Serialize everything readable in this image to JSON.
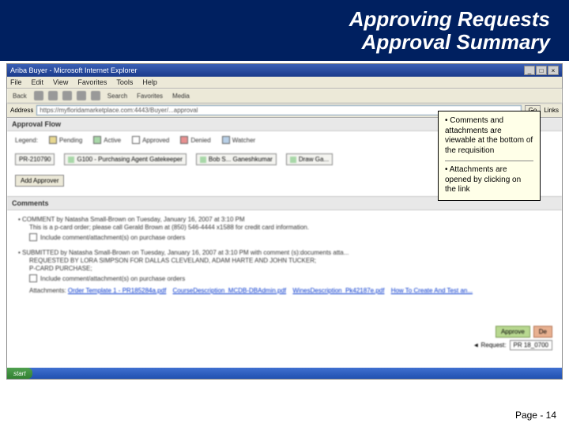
{
  "title": {
    "line1": "Approving Requests",
    "line2": "Approval Summary"
  },
  "window": {
    "title": "Ariba Buyer - Microsoft Internet Explorer",
    "menu": [
      "File",
      "Edit",
      "View",
      "Favorites",
      "Tools",
      "Help"
    ],
    "toolbar": {
      "back": "Back",
      "search": "Search",
      "favorites": "Favorites",
      "media": "Media"
    },
    "address_label": "Address",
    "address": "https://myfloridamarketplace.com:4443/Buyer/...approval",
    "go": "Go",
    "links": "Links"
  },
  "approval_flow": {
    "header": "Approval Flow",
    "legend_label": "Legend:",
    "legend": [
      {
        "label": "Pending",
        "cls": "lb-pend"
      },
      {
        "label": "Active",
        "cls": "lb-act"
      },
      {
        "label": "Approved",
        "cls": "lb-appr"
      },
      {
        "label": "Denied",
        "cls": "lb-den"
      },
      {
        "label": "Watcher",
        "cls": "lb-wat"
      }
    ],
    "nodes": [
      "PR-210790",
      "G100 - Purchasing Agent Gatekeeper",
      "Bob S... Ganeshkumar",
      "Draw Ga..."
    ],
    "add_approver": "Add Approver"
  },
  "comments": {
    "header": "Comments",
    "items": [
      {
        "head": "COMMENT by Natasha Small-Brown on Tuesday, January 16, 2007 at 3:10 PM",
        "body": "This is a p-card order; please call Gerald Brown at (850) 546-4444 x1588 for credit card information.",
        "chk_label": "Include comment/attachment(s) on purchase orders"
      },
      {
        "head": "SUBMITTED by Natasha Small-Brown on Tuesday, January 16, 2007 at 3:10 PM with comment (s):documents atta...",
        "body": "REQUESTED BY LORA SIMPSON FOR DALLAS CLEVELAND, ADAM HARTE AND JOHN TUCKER;",
        "body2": "P-CARD PURCHASE;",
        "chk_label": "Include comment/attachment(s) on purchase orders",
        "attach_label": "Attachments:",
        "attachments": [
          "Order Template 1 - PR185284a.pdf",
          "CourseDescription_MCDB-DBAdmin.pdf",
          "WinesDescription_Pk42187e.pdf",
          "How To Create And Test an..."
        ]
      }
    ]
  },
  "callout": {
    "p1": "• Comments and attachments are viewable at the bottom of the requisition",
    "p2": "• Attachments are opened by clicking on the link"
  },
  "bottom": {
    "approve": "Approve",
    "deny": "De",
    "req_label": "◄ Request:",
    "req_val": "PR 18_0700"
  },
  "start": "start",
  "page": "Page - 14"
}
